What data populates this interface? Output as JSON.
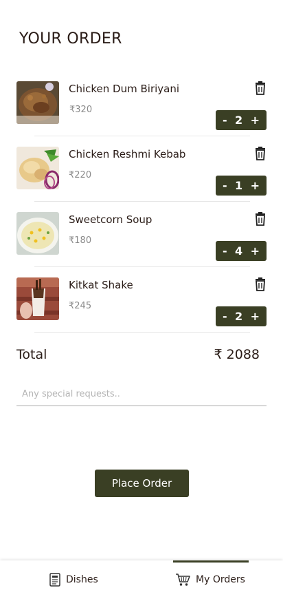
{
  "header": {
    "title": "YOUR ORDER"
  },
  "items": [
    {
      "name": "Chicken Dum Biriyani",
      "price": "₹320",
      "quantity": "2",
      "image": "biriyani"
    },
    {
      "name": "Chicken Reshmi Kebab",
      "price": "₹220",
      "quantity": "1",
      "image": "kebab"
    },
    {
      "name": "Sweetcorn Soup",
      "price": "₹180",
      "quantity": "4",
      "image": "soup"
    },
    {
      "name": "Kitkat Shake",
      "price": "₹245",
      "quantity": "2",
      "image": "shake"
    }
  ],
  "stepper": {
    "minus": "-",
    "plus": "+"
  },
  "total": {
    "label": "Total",
    "value": "₹ 2088"
  },
  "special_requests": {
    "placeholder": "Any special requests..",
    "value": ""
  },
  "actions": {
    "place_order": "Place Order"
  },
  "bottom_nav": [
    {
      "label": "Dishes",
      "icon": "menu-icon",
      "active": false
    },
    {
      "label": "My Orders",
      "icon": "cart-icon",
      "active": true
    }
  ],
  "colors": {
    "accent": "#3a3f24",
    "text": "#2a1c17",
    "muted": "#8a8a8a"
  }
}
